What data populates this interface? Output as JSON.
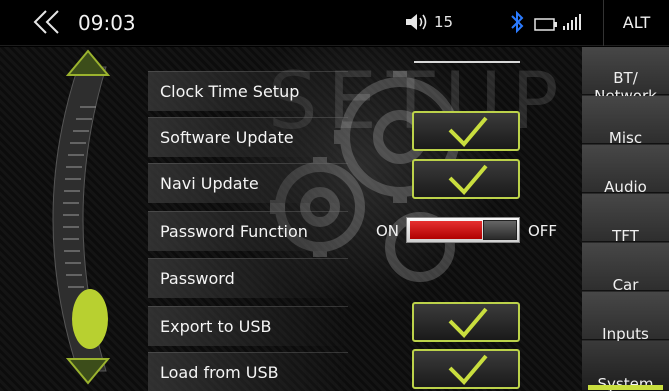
{
  "status_bar": {
    "time": "09:03",
    "volume": "15",
    "alt_label": "ALT"
  },
  "background": {
    "watermark": "SETUP"
  },
  "settings": {
    "items": [
      {
        "label": "Clock Time Setup"
      },
      {
        "label": "Software Update"
      },
      {
        "label": "Navi Update"
      },
      {
        "label": "Password Function"
      },
      {
        "label": "Password"
      },
      {
        "label": "Export to USB"
      },
      {
        "label": "Load from USB"
      }
    ],
    "password_toggle": {
      "on_label": "ON",
      "off_label": "OFF",
      "state": "ON"
    }
  },
  "tabs": [
    {
      "label": "BT/\nNetwork"
    },
    {
      "label": "Misc"
    },
    {
      "label": "Audio"
    },
    {
      "label": "TFT"
    },
    {
      "label": "Car"
    },
    {
      "label": "Inputs"
    },
    {
      "label": "System",
      "active": true
    }
  ],
  "colors": {
    "accent": "#c9de3e",
    "toggle_on": "#d42020"
  }
}
